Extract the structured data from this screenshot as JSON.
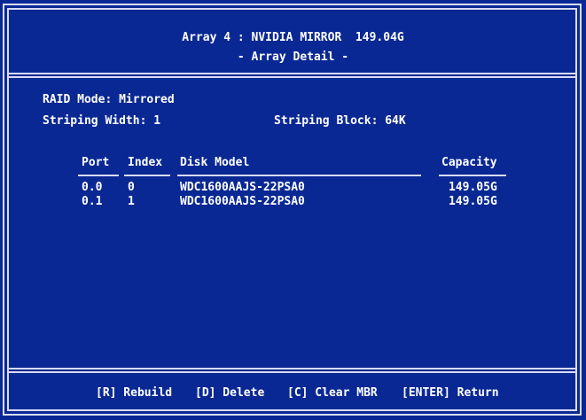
{
  "header": {
    "title": "Array 4 : NVIDIA MIRROR  149.04G",
    "subtitle": "- Array Detail -"
  },
  "info": {
    "raid_mode": "RAID Mode: Mirrored",
    "striping_width": "Striping Width: 1",
    "striping_block": "Striping Block: 64K"
  },
  "table": {
    "columns": {
      "port": "Port",
      "index": "Index",
      "disk_model": "Disk Model",
      "capacity": "Capacity"
    },
    "rows": [
      {
        "port": "0.0",
        "index": "0",
        "disk_model": "WDC1600AAJS-22PSA0",
        "capacity": "149.05G"
      },
      {
        "port": "0.1",
        "index": "1",
        "disk_model": "WDC1600AAJS-22PSA0",
        "capacity": "149.05G"
      }
    ]
  },
  "footer": {
    "rebuild": "[R] Rebuild",
    "delete": "[D] Delete",
    "clear_mbr": "[C] Clear MBR",
    "return": "[ENTER] Return"
  },
  "colors": {
    "background": "#0a2894",
    "text": "#ffffff",
    "frame": "#d8dcf0"
  }
}
